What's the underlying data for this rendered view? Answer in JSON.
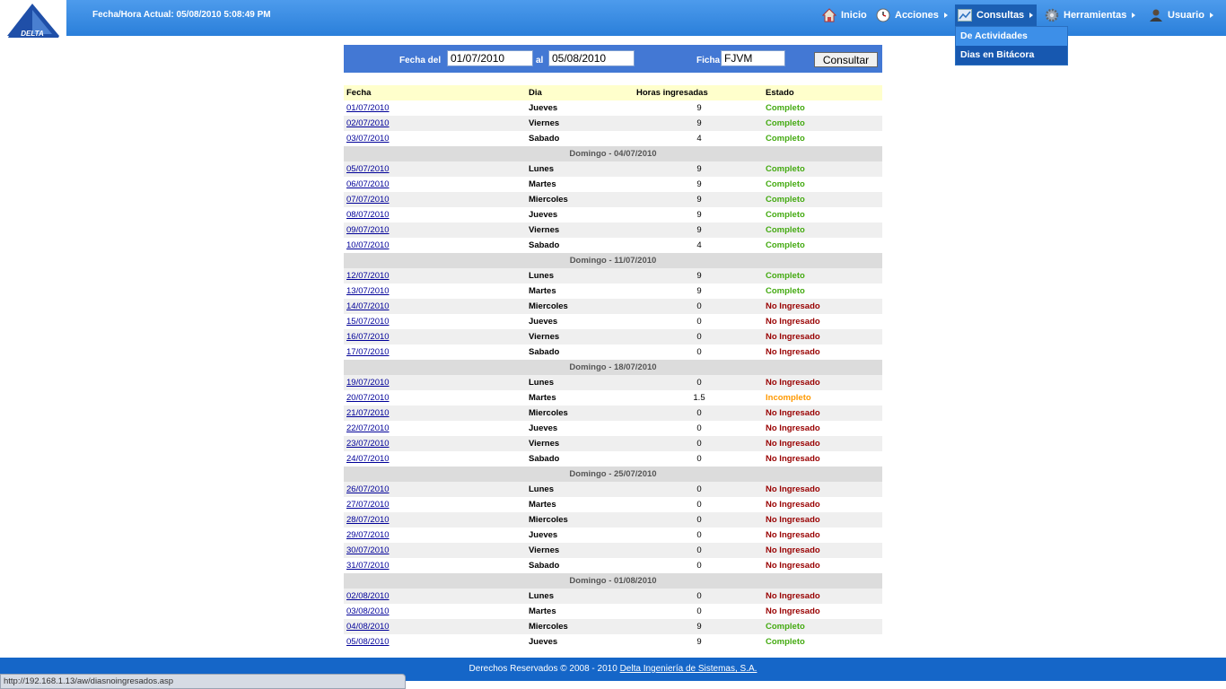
{
  "header": {
    "logo_text": "DELTA",
    "datetime": "Fecha/Hora Actual: 05/08/2010 5:08:49 PM"
  },
  "nav": {
    "inicio": "Inicio",
    "acciones": "Acciones",
    "consultas": "Consultas",
    "herramientas": "Herramientas",
    "usuario": "Usuario"
  },
  "dropdown": {
    "items": [
      "De Actividades",
      "Dias en Bitácora"
    ]
  },
  "filter": {
    "fecha_del_label": "Fecha del",
    "fecha_del_value": "01/07/2010",
    "al_label": "al",
    "al_value": "05/08/2010",
    "ficha_label": "Ficha",
    "ficha_value": "FJVM",
    "consultar_label": "Consultar"
  },
  "table": {
    "headers": {
      "fecha": "Fecha",
      "dia": "Dia",
      "horas": "Horas ingresadas",
      "estado": "Estado"
    },
    "rows": [
      {
        "fecha": "01/07/2010",
        "dia": "Jueves",
        "horas": "9",
        "estado": "Completo"
      },
      {
        "fecha": "02/07/2010",
        "dia": "Viernes",
        "horas": "9",
        "estado": "Completo"
      },
      {
        "fecha": "03/07/2010",
        "dia": "Sabado",
        "horas": "4",
        "estado": "Completo"
      },
      {
        "sunday": "Domingo - 04/07/2010"
      },
      {
        "fecha": "05/07/2010",
        "dia": "Lunes",
        "horas": "9",
        "estado": "Completo"
      },
      {
        "fecha": "06/07/2010",
        "dia": "Martes",
        "horas": "9",
        "estado": "Completo"
      },
      {
        "fecha": "07/07/2010",
        "dia": "Miercoles",
        "horas": "9",
        "estado": "Completo"
      },
      {
        "fecha": "08/07/2010",
        "dia": "Jueves",
        "horas": "9",
        "estado": "Completo"
      },
      {
        "fecha": "09/07/2010",
        "dia": "Viernes",
        "horas": "9",
        "estado": "Completo"
      },
      {
        "fecha": "10/07/2010",
        "dia": "Sabado",
        "horas": "4",
        "estado": "Completo"
      },
      {
        "sunday": "Domingo - 11/07/2010"
      },
      {
        "fecha": "12/07/2010",
        "dia": "Lunes",
        "horas": "9",
        "estado": "Completo"
      },
      {
        "fecha": "13/07/2010",
        "dia": "Martes",
        "horas": "9",
        "estado": "Completo"
      },
      {
        "fecha": "14/07/2010",
        "dia": "Miercoles",
        "horas": "0",
        "estado": "No Ingresado"
      },
      {
        "fecha": "15/07/2010",
        "dia": "Jueves",
        "horas": "0",
        "estado": "No Ingresado"
      },
      {
        "fecha": "16/07/2010",
        "dia": "Viernes",
        "horas": "0",
        "estado": "No Ingresado"
      },
      {
        "fecha": "17/07/2010",
        "dia": "Sabado",
        "horas": "0",
        "estado": "No Ingresado"
      },
      {
        "sunday": "Domingo - 18/07/2010"
      },
      {
        "fecha": "19/07/2010",
        "dia": "Lunes",
        "horas": "0",
        "estado": "No Ingresado"
      },
      {
        "fecha": "20/07/2010",
        "dia": "Martes",
        "horas": "1.5",
        "estado": "Incompleto"
      },
      {
        "fecha": "21/07/2010",
        "dia": "Miercoles",
        "horas": "0",
        "estado": "No Ingresado"
      },
      {
        "fecha": "22/07/2010",
        "dia": "Jueves",
        "horas": "0",
        "estado": "No Ingresado"
      },
      {
        "fecha": "23/07/2010",
        "dia": "Viernes",
        "horas": "0",
        "estado": "No Ingresado"
      },
      {
        "fecha": "24/07/2010",
        "dia": "Sabado",
        "horas": "0",
        "estado": "No Ingresado"
      },
      {
        "sunday": "Domingo - 25/07/2010"
      },
      {
        "fecha": "26/07/2010",
        "dia": "Lunes",
        "horas": "0",
        "estado": "No Ingresado"
      },
      {
        "fecha": "27/07/2010",
        "dia": "Martes",
        "horas": "0",
        "estado": "No Ingresado"
      },
      {
        "fecha": "28/07/2010",
        "dia": "Miercoles",
        "horas": "0",
        "estado": "No Ingresado"
      },
      {
        "fecha": "29/07/2010",
        "dia": "Jueves",
        "horas": "0",
        "estado": "No Ingresado"
      },
      {
        "fecha": "30/07/2010",
        "dia": "Viernes",
        "horas": "0",
        "estado": "No Ingresado"
      },
      {
        "fecha": "31/07/2010",
        "dia": "Sabado",
        "horas": "0",
        "estado": "No Ingresado"
      },
      {
        "sunday": "Domingo - 01/08/2010"
      },
      {
        "fecha": "02/08/2010",
        "dia": "Lunes",
        "horas": "0",
        "estado": "No Ingresado"
      },
      {
        "fecha": "03/08/2010",
        "dia": "Martes",
        "horas": "0",
        "estado": "No Ingresado"
      },
      {
        "fecha": "04/08/2010",
        "dia": "Miercoles",
        "horas": "9",
        "estado": "Completo"
      },
      {
        "fecha": "05/08/2010",
        "dia": "Jueves",
        "horas": "9",
        "estado": "Completo"
      }
    ]
  },
  "status_colors": {
    "Completo": "#44aa11",
    "No Ingresado": "#990000",
    "Incompleto": "#ff9900"
  },
  "footer": {
    "text": "Derechos Reservados © 2008 - 2010",
    "link": "Delta Ingeniería de Sistemas, S.A."
  },
  "statusbar": {
    "url": "http://192.168.1.13/aw/diasnoingresados.asp"
  }
}
